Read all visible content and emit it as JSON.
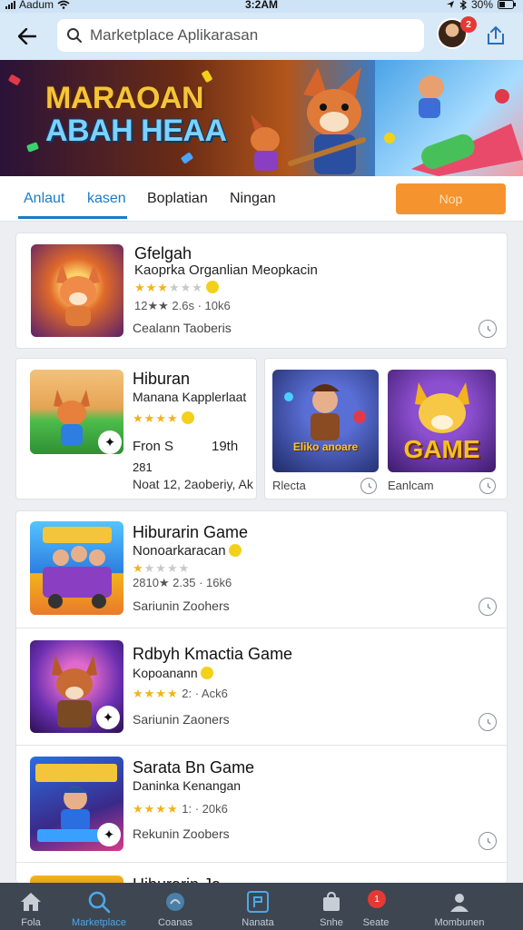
{
  "status_bar": {
    "carrier": "Aadum",
    "time": "3:2AM",
    "battery": "30%"
  },
  "header": {
    "search_placeholder": "Marketplace Aplikarasan",
    "notif_count": "2"
  },
  "banner": {
    "title_line1": "MARAOAN",
    "title_line2": "ABAH HEAA"
  },
  "tabs": [
    {
      "label": "Anlaut",
      "active": true
    },
    {
      "label": "kasen",
      "active": false
    },
    {
      "label": "Boplatian",
      "active": false
    },
    {
      "label": "Ningan",
      "active": false
    }
  ],
  "action_button": "Nop",
  "apps": [
    {
      "title": "Gfelgah",
      "subtitle": "Kaoprka Organlian Meopkacin",
      "rating_text": "12★★ 2.6s · 10k6",
      "stars": 3,
      "footer": "Cealann Taoberis"
    },
    {
      "title": "Hiburan",
      "subtitle": "Manana Kapplerlaat",
      "rating_text": "",
      "stars": 4,
      "stat_left": "Fron S",
      "stat_right": "19th",
      "line3": "281",
      "footer": "Noat 12, 2aoberiy, Ak"
    },
    {
      "title": "Hiburarin Game",
      "subtitle": "Nonoarkaracan",
      "rating_text": "2810★ 2.35 · 16k6",
      "stars": 1,
      "footer": "Sariunin Zoohers"
    },
    {
      "title": "Rdbyh Kmactia Game",
      "subtitle": "Kopoanann",
      "rating_text": "2: · Ack6",
      "stars": 4,
      "footer": "Sariunin Zaoners"
    },
    {
      "title": "Sarata Bn Game",
      "subtitle": "Daninka Kenangan",
      "rating_text": "1: · 20k6",
      "stars": 4,
      "footer": "Rekunin Zoobers"
    },
    {
      "title": "Hiburarin Ja",
      "subtitle": "",
      "rating_text": "",
      "stars": 0,
      "footer": ""
    }
  ],
  "tiles": [
    {
      "label": "Rlecta",
      "art_text": "Eliko anoare"
    },
    {
      "label": "Eanlcam",
      "art_text": "GAME"
    }
  ],
  "bottom_nav": [
    {
      "label": "Fola",
      "icon": "home-icon",
      "active": false
    },
    {
      "label": "Marketplace",
      "icon": "search-icon",
      "active": true
    },
    {
      "label": "Coanas",
      "icon": "game-icon",
      "active": false
    },
    {
      "label": "Nanata",
      "icon": "box-icon",
      "active": false
    },
    {
      "label": "Snhe",
      "icon": "bag-icon",
      "active": false
    },
    {
      "label": "Seate",
      "icon": "notification-icon",
      "active": false,
      "badge": "1"
    },
    {
      "label": "Mombunen",
      "icon": "profile-icon",
      "active": false
    }
  ],
  "colors": {
    "accent": "#1a7bc8",
    "orange": "#f5932f",
    "nav_bg": "#3d4651",
    "star": "#f3b31b"
  }
}
